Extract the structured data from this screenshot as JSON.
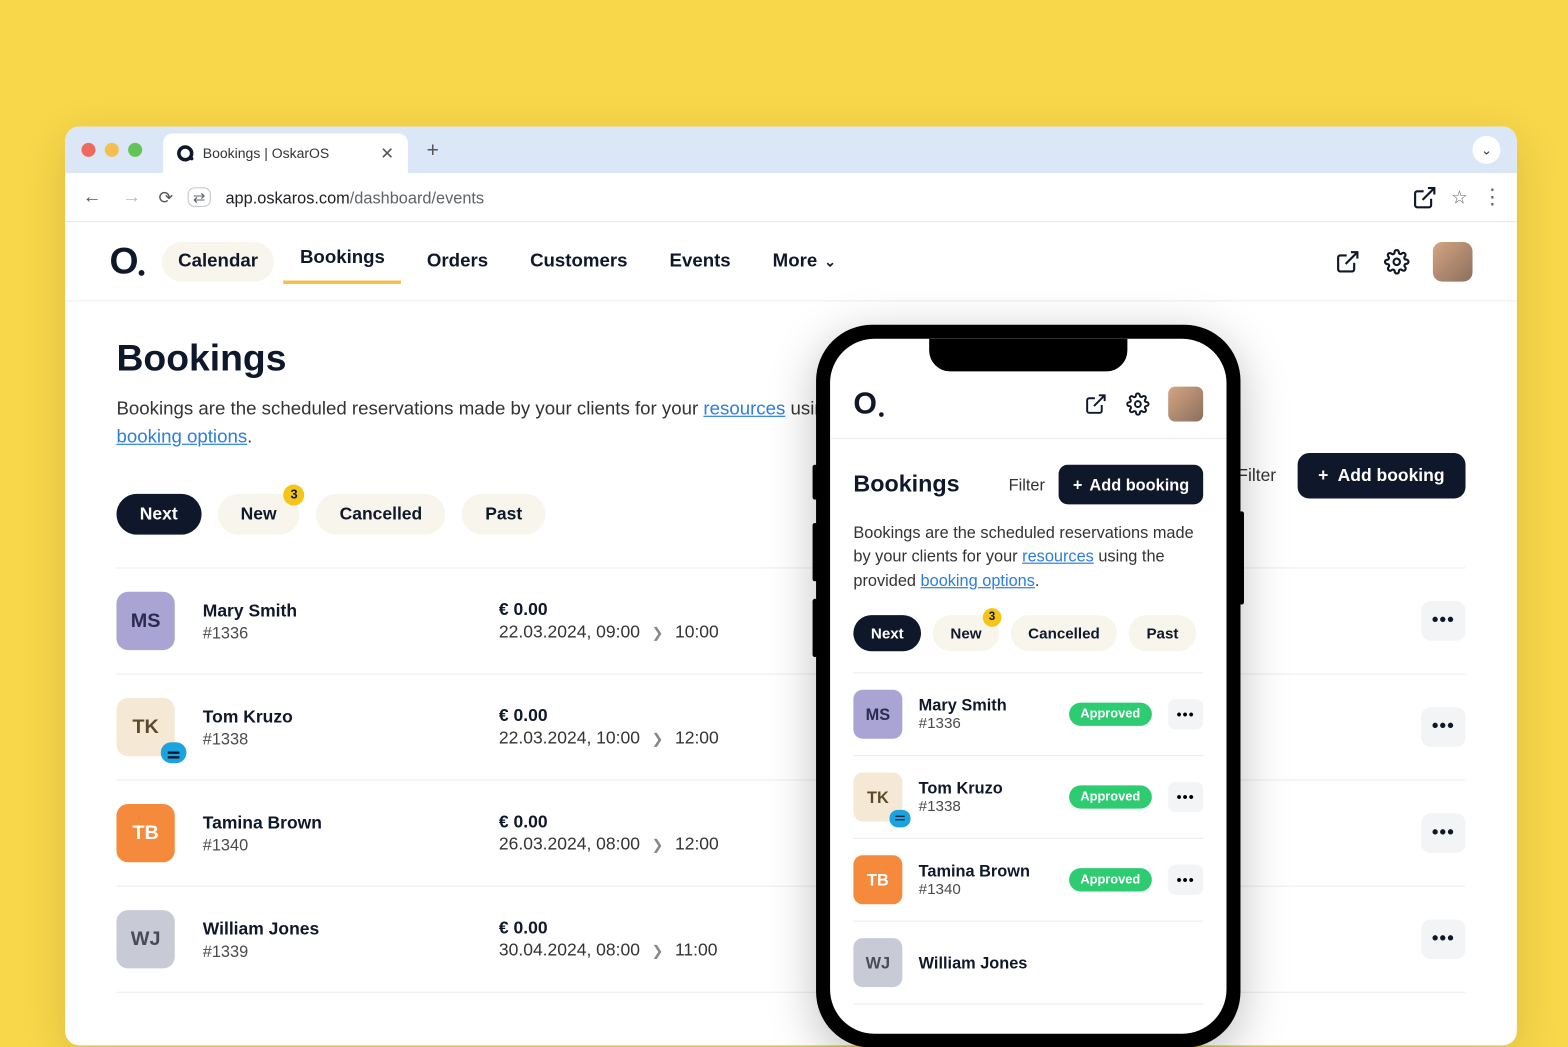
{
  "browser": {
    "tab_title": "Bookings | OskarOS",
    "url_domain": "app.oskaros.com",
    "url_path": "/dashboard/events"
  },
  "nav": {
    "calendar": "Calendar",
    "bookings": "Bookings",
    "orders": "Orders",
    "customers": "Customers",
    "events": "Events",
    "more": "More"
  },
  "page": {
    "title": "Bookings",
    "desc_1": "Bookings are the scheduled reservations made by your clients for your ",
    "desc_link1": "resources",
    "desc_2": " using the p",
    "desc_link2": "booking options",
    "desc_3": ".",
    "filter_label": "Filter",
    "add_label": "Add booking"
  },
  "tabs": {
    "next": "Next",
    "new": "New",
    "new_badge": "3",
    "cancelled": "Cancelled",
    "past": "Past"
  },
  "rows": [
    {
      "initials": "MS",
      "name": "Mary Smith",
      "id": "#1336",
      "price": "€ 0.00",
      "date": "22.03.2024, 09:00",
      "end": "10:00",
      "avatar": "rav-purple",
      "note": false
    },
    {
      "initials": "TK",
      "name": "Tom Kruzo",
      "id": "#1338",
      "price": "€ 0.00",
      "date": "22.03.2024, 10:00",
      "end": "12:00",
      "avatar": "rav-cream",
      "note": true
    },
    {
      "initials": "TB",
      "name": "Tamina Brown",
      "id": "#1340",
      "price": "€ 0.00",
      "date": "26.03.2024, 08:00",
      "end": "12:00",
      "avatar": "rav-orange",
      "note": false
    },
    {
      "initials": "WJ",
      "name": "William Jones",
      "id": "#1339",
      "price": "€ 0.00",
      "date": "30.04.2024, 08:00",
      "end": "11:00",
      "avatar": "rav-grey",
      "note": false
    }
  ],
  "mobile": {
    "title": "Bookings",
    "filter": "Filter",
    "add": "Add booking",
    "desc_1": "Bookings are the scheduled reservations made by your clients for your ",
    "desc_link1": "resources",
    "desc_2": " using the provided ",
    "desc_link2": "booking options",
    "desc_3": ".",
    "status": "Approved",
    "rows": [
      {
        "initials": "MS",
        "name": "Mary Smith",
        "id": "#1336",
        "avatar": "rav-purple",
        "note": false
      },
      {
        "initials": "TK",
        "name": "Tom Kruzo",
        "id": "#1338",
        "avatar": "rav-cream",
        "note": true
      },
      {
        "initials": "TB",
        "name": "Tamina Brown",
        "id": "#1340",
        "avatar": "rav-orange",
        "note": false
      },
      {
        "initials": "WJ",
        "name": "William Jones",
        "id": "",
        "avatar": "rav-grey",
        "note": false
      }
    ]
  }
}
